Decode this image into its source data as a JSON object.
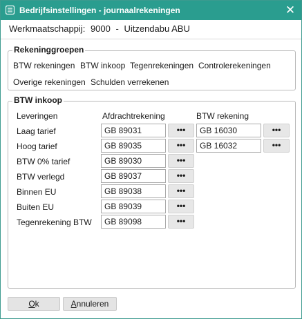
{
  "window": {
    "title": "Bedrijfsinstellingen - journaalrekeningen",
    "close_glyph": "✕"
  },
  "company": {
    "label": "Werkmaatschappij:",
    "code": "9000",
    "separator": "-",
    "name": "Uitzendabu ABU"
  },
  "groups": {
    "legend": "Rekeninggroepen",
    "links": [
      "BTW rekeningen",
      "BTW inkoop",
      "Tegenrekeningen",
      "Controlerekeningen",
      "Overige rekeningen",
      "Schulden verrekenen"
    ]
  },
  "btw_inkoop": {
    "legend": "BTW inkoop",
    "headers": {
      "leveringen": "Leveringen",
      "afdracht": "Afdrachtrekening",
      "btw": "BTW rekening"
    },
    "rows": [
      {
        "label": "Laag tarief",
        "afdracht": "GB 89031",
        "btw": "GB 16030"
      },
      {
        "label": "Hoog tarief",
        "afdracht": "GB 89035",
        "btw": "GB 16032"
      },
      {
        "label": "BTW 0% tarief",
        "afdracht": "GB 89030",
        "btw": ""
      },
      {
        "label": "BTW verlegd",
        "afdracht": "GB 89037",
        "btw": ""
      },
      {
        "label": "Binnen EU",
        "afdracht": "GB 89038",
        "btw": ""
      },
      {
        "label": "Buiten EU",
        "afdracht": "GB 89039",
        "btw": ""
      },
      {
        "label": "Tegenrekening BTW",
        "afdracht": "GB 89098",
        "btw": ""
      }
    ],
    "lookup_glyph": "•••"
  },
  "footer": {
    "ok_first": "O",
    "ok_rest": "k",
    "cancel_first": "A",
    "cancel_rest": "nnuleren"
  }
}
